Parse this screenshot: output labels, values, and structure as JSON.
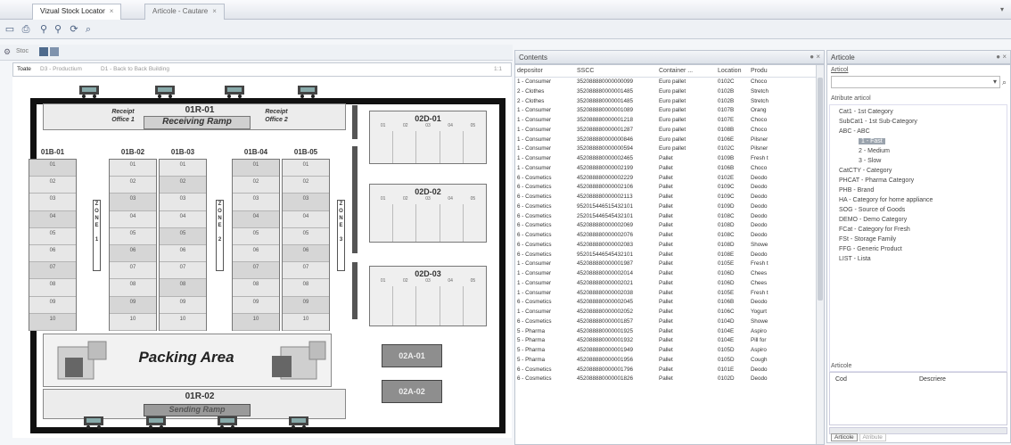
{
  "window": {
    "tabs": [
      {
        "label": "Vizual Stock Locator",
        "active": true
      },
      {
        "label": "Articole - Cautare",
        "active": false
      }
    ]
  },
  "stock_toolbar": {
    "label": "Stoc"
  },
  "map": {
    "tabs": [
      "Toate",
      "D3 - Productium",
      "D1 - Back to Back Building"
    ],
    "zoom": "1:1",
    "receipt_office_1": "Receipt Office 1",
    "receipt_office_2": "Receipt Office 2",
    "receiving_code": "01R-01",
    "receiving_label": "Receiving Ramp",
    "sending_code": "01R-02",
    "sending_label": "Sending Ramp",
    "packing_label": "Packing Area",
    "shelves": [
      "01B-01",
      "01B-02",
      "01B-03",
      "01B-04",
      "01B-05"
    ],
    "shelf_rows": [
      "01",
      "02",
      "03",
      "04",
      "05",
      "06",
      "07",
      "08",
      "09",
      "10"
    ],
    "zones": [
      "ZONE 1",
      "ZONE 2",
      "ZONE 3"
    ],
    "areas_02d": [
      "02D-01",
      "02D-02",
      "02D-03"
    ],
    "area_cols": [
      "01",
      "02",
      "03",
      "04",
      "05"
    ],
    "areas_02a": [
      "02A-01",
      "02A-02"
    ]
  },
  "contents": {
    "title": "Contents",
    "columns": [
      "depositor",
      "SSCC",
      "Container ...",
      "Location",
      "Produ"
    ],
    "rows": [
      [
        "1 - Consumer",
        "352088880000000099",
        "Euro pallet",
        "0102C",
        "Choco"
      ],
      [
        "2 - Clothes",
        "352088880000001485",
        "Euro pallet",
        "0102B",
        "Stretch"
      ],
      [
        "2 - Clothes",
        "352088880000001485",
        "Euro pallet",
        "0102B",
        "Stretch"
      ],
      [
        "1 - Consumer",
        "352088880000001089",
        "Euro pallet",
        "0107B",
        "Orang"
      ],
      [
        "1 - Consumer",
        "352088880000001218",
        "Euro pallet",
        "0107E",
        "Choco"
      ],
      [
        "1 - Consumer",
        "352088880000001287",
        "Euro pallet",
        "0108B",
        "Choco"
      ],
      [
        "1 - Consumer",
        "352088880000000846",
        "Euro pallet",
        "0106E",
        "Pilsner"
      ],
      [
        "1 - Consumer",
        "352088880000000594",
        "Euro pallet",
        "0102C",
        "Pilsner"
      ],
      [
        "1 - Consumer",
        "452088880000002465",
        "Pallet",
        "0109B",
        "Fresh t"
      ],
      [
        "1 - Consumer",
        "452088880000002199",
        "Pallet",
        "0106B",
        "Choco"
      ],
      [
        "6 - Cosmetics",
        "452088880000002229",
        "Pallet",
        "0102E",
        "Deodo"
      ],
      [
        "6 - Cosmetics",
        "452088880000002106",
        "Pallet",
        "0109C",
        "Deodo"
      ],
      [
        "6 - Cosmetics",
        "452088880000002113",
        "Pallet",
        "0109C",
        "Deodo"
      ],
      [
        "6 - Cosmetics",
        "952015446515432101",
        "Pallet",
        "0109D",
        "Deodo"
      ],
      [
        "6 - Cosmetics",
        "252015446545432101",
        "Pallet",
        "0108C",
        "Deodo"
      ],
      [
        "6 - Cosmetics",
        "452088880000002069",
        "Pallet",
        "0108D",
        "Deodo"
      ],
      [
        "6 - Cosmetics",
        "452088880000002076",
        "Pallet",
        "0108C",
        "Deodo"
      ],
      [
        "6 - Cosmetics",
        "452088880000002083",
        "Pallet",
        "0108D",
        "Showe"
      ],
      [
        "6 - Cosmetics",
        "952015446545432101",
        "Pallet",
        "0108E",
        "Deodo"
      ],
      [
        "1 - Consumer",
        "452088880000001987",
        "Pallet",
        "0105E",
        "Fresh t"
      ],
      [
        "1 - Consumer",
        "452088880000002014",
        "Pallet",
        "0106D",
        "Chees"
      ],
      [
        "1 - Consumer",
        "452088880000002021",
        "Pallet",
        "0106D",
        "Chees"
      ],
      [
        "1 - Consumer",
        "452088880000002038",
        "Pallet",
        "0105E",
        "Fresh t"
      ],
      [
        "6 - Cosmetics",
        "452088880000002045",
        "Pallet",
        "0106B",
        "Deodo"
      ],
      [
        "1 - Consumer",
        "452088880000002052",
        "Pallet",
        "0106C",
        "Yogurt"
      ],
      [
        "6 - Cosmetics",
        "452088880000001857",
        "Pallet",
        "0104D",
        "Showe"
      ],
      [
        "5 - Pharma",
        "452088880000001925",
        "Pallet",
        "0104E",
        "Aspiro"
      ],
      [
        "5 - Pharma",
        "452088880000001932",
        "Pallet",
        "0104E",
        "Pill for"
      ],
      [
        "5 - Pharma",
        "452088880000001949",
        "Pallet",
        "0105D",
        "Aspiro"
      ],
      [
        "5 - Pharma",
        "452088880000001956",
        "Pallet",
        "0105D",
        "Cough"
      ],
      [
        "6 - Cosmetics",
        "452088880000001796",
        "Pallet",
        "0101E",
        "Deodo"
      ],
      [
        "6 - Cosmetics",
        "452088880000001826",
        "Pallet",
        "0102D",
        "Deodo"
      ]
    ]
  },
  "articole_panel": {
    "title": "Articole",
    "search_label": "Articol",
    "attr_label": "Atribute articol",
    "tree": [
      {
        "label": "Cat1 - 1st Category",
        "indent": 0,
        "selected": false
      },
      {
        "label": "SubCat1 - 1st Sub-Category",
        "indent": 0,
        "selected": false
      },
      {
        "label": "ABC - ABC",
        "indent": 0,
        "selected": false
      },
      {
        "label": "1 - Fast",
        "indent": 1,
        "selected": true
      },
      {
        "label": "2 - Medium",
        "indent": 1,
        "selected": false
      },
      {
        "label": "3 - Slow",
        "indent": 1,
        "selected": false
      },
      {
        "label": "CatCTY - Category",
        "indent": 0,
        "selected": false
      },
      {
        "label": "PHCAT - Pharma Category",
        "indent": 0,
        "selected": false
      },
      {
        "label": "PHB - Brand",
        "indent": 0,
        "selected": false
      },
      {
        "label": "HA - Category for home appliance",
        "indent": 0,
        "selected": false
      },
      {
        "label": "SOG - Source of Goods",
        "indent": 0,
        "selected": false
      },
      {
        "label": "DEMO - Demo Category",
        "indent": 0,
        "selected": false
      },
      {
        "label": "FCat - Category for Fresh",
        "indent": 0,
        "selected": false
      },
      {
        "label": "FSt - Storage Family",
        "indent": 0,
        "selected": false
      },
      {
        "label": "FFG - Generic Product",
        "indent": 0,
        "selected": false
      },
      {
        "label": "LIST - Lista",
        "indent": 0,
        "selected": false
      }
    ],
    "results_label": "Articole",
    "result_columns": [
      "Cod",
      "Descriere"
    ],
    "bottom_tabs": [
      "Articole",
      "Atribute"
    ]
  }
}
